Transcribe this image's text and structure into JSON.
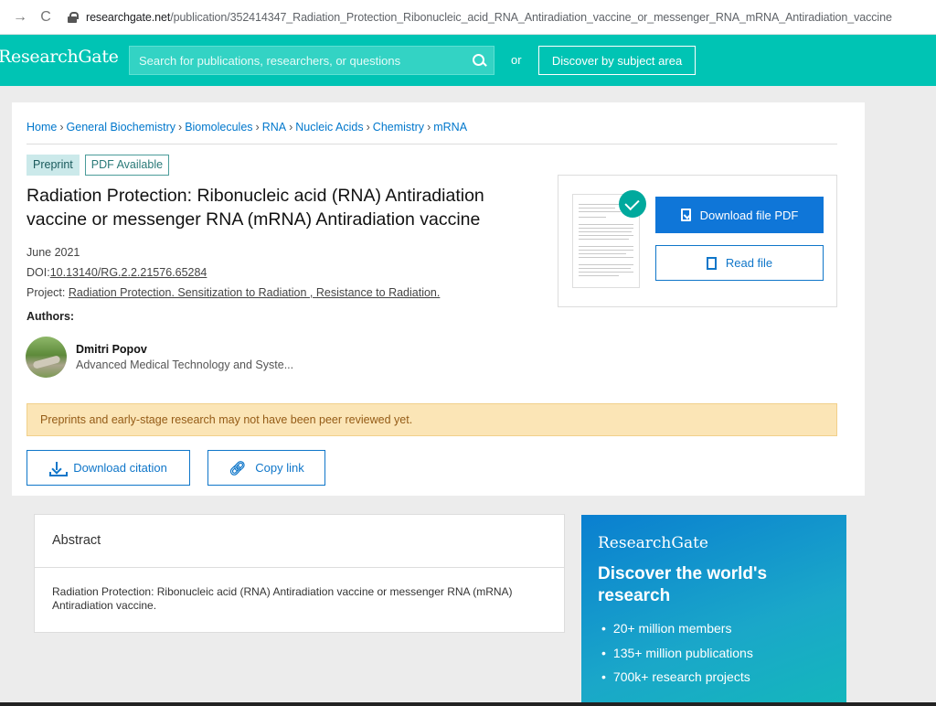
{
  "browser": {
    "host": "researchgate.net",
    "path": "/publication/352414347_Radiation_Protection_Ribonucleic_acid_RNA_Antiradiation_vaccine_or_messenger_RNA_mRNA_Antiradiation_vaccine"
  },
  "header": {
    "logo": "ResearchGate",
    "search_placeholder": "Search for publications, researchers, or questions",
    "or": "or",
    "discover": "Discover by subject area"
  },
  "breadcrumb": [
    "Home",
    "General Biochemistry",
    "Biomolecules",
    "RNA",
    "Nucleic Acids",
    "Chemistry",
    "mRNA"
  ],
  "badges": {
    "type": "Preprint",
    "pdf": "PDF Available"
  },
  "publication": {
    "title": "Radiation Protection: Ribonucleic acid (RNA) Antiradiation vaccine or messenger RNA (mRNA) Antiradiation vaccine",
    "date": "June 2021",
    "doi_label": "DOI:",
    "doi": "10.13140/RG.2.2.21576.65284",
    "project_label": "Project:",
    "project": "Radiation Protection. Sensitization to Radiation , Resistance to Radiation."
  },
  "authors": {
    "heading": "Authors:",
    "list": [
      {
        "name": "Dmitri Popov",
        "institution": "Advanced Medical Technology and Syste..."
      }
    ]
  },
  "warning": "Preprints and early-stage research may not have been peer reviewed yet.",
  "actions": {
    "download_citation": "Download citation",
    "copy_link": "Copy link"
  },
  "file_box": {
    "download_pdf": "Download file PDF",
    "read_file": "Read file"
  },
  "abstract": {
    "heading": "Abstract",
    "body": "Radiation Protection: Ribonucleic acid (RNA) Antiradiation vaccine or messenger RNA (mRNA) Antiradiation vaccine."
  },
  "promo": {
    "logo": "ResearchGate",
    "heading": "Discover the world's research",
    "items": [
      "20+ million members",
      "135+ million publications",
      "700k+ research projects"
    ]
  },
  "colors": {
    "brand": "#00c4b4",
    "link": "#0f76c9",
    "warning_bg": "#fbe5b6"
  },
  "icons": [
    "back-arrow-icon",
    "reload-icon",
    "lock-icon",
    "search-icon",
    "check-icon",
    "download-icon",
    "link-icon",
    "file-icon"
  ]
}
